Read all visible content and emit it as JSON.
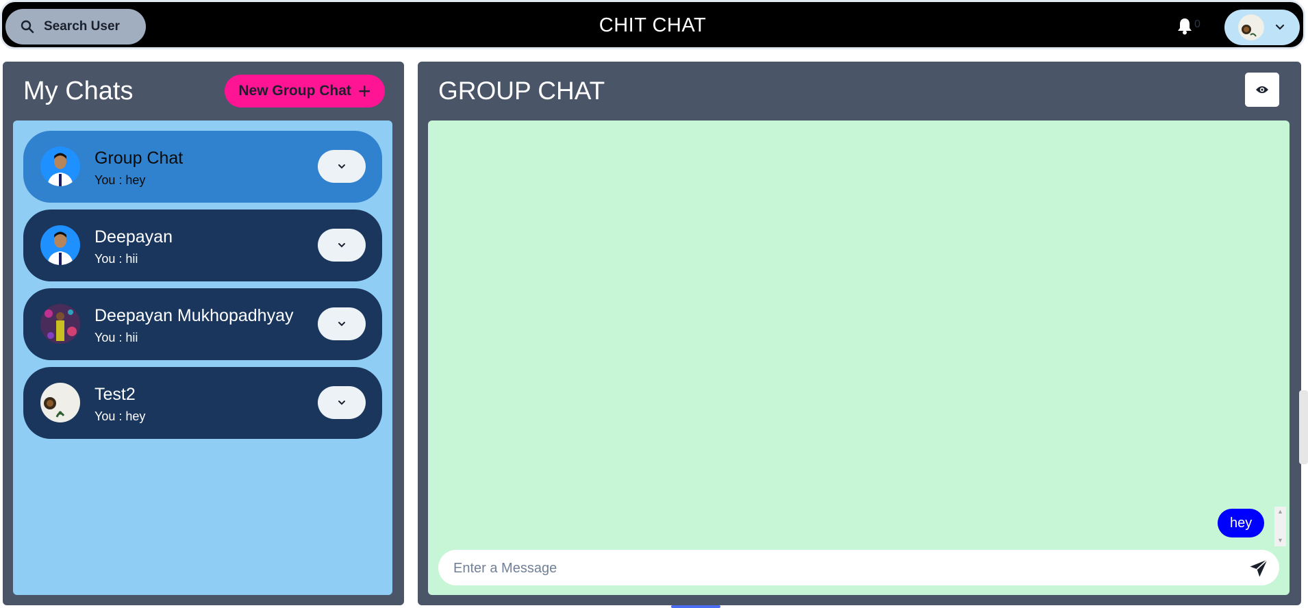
{
  "header": {
    "search_label": "Search User",
    "app_title": "CHIT CHAT",
    "notification_count": "0"
  },
  "sidebar": {
    "title": "My Chats",
    "new_group_label": "New Group Chat",
    "chats": [
      {
        "name": "Group Chat",
        "last_message": "You : hey",
        "active": true
      },
      {
        "name": "Deepayan",
        "last_message": "You : hii",
        "active": false
      },
      {
        "name": "Deepayan Mukhopadhyay",
        "last_message": "You : hii",
        "active": false
      },
      {
        "name": "Test2",
        "last_message": "You : hey",
        "active": false
      }
    ]
  },
  "conversation": {
    "title": "GROUP CHAT",
    "messages": [
      {
        "text": "hey",
        "from_me": true
      }
    ],
    "input_placeholder": "Enter a Message"
  },
  "colors": {
    "header_bg": "#000000",
    "panel_bg": "#4a5568",
    "chat_list_bg": "#90cdf4",
    "active_chat": "#3182ce",
    "chat_item": "#1a365d",
    "new_group_button": "#ff1493",
    "messages_bg": "#c6f6d5",
    "my_bubble": "#0000ff"
  },
  "icons": {
    "search": "search-icon",
    "bell": "bell-icon",
    "chevron": "chevron-down-icon",
    "plus": "plus-icon",
    "eye": "eye-icon",
    "send": "send-icon"
  }
}
